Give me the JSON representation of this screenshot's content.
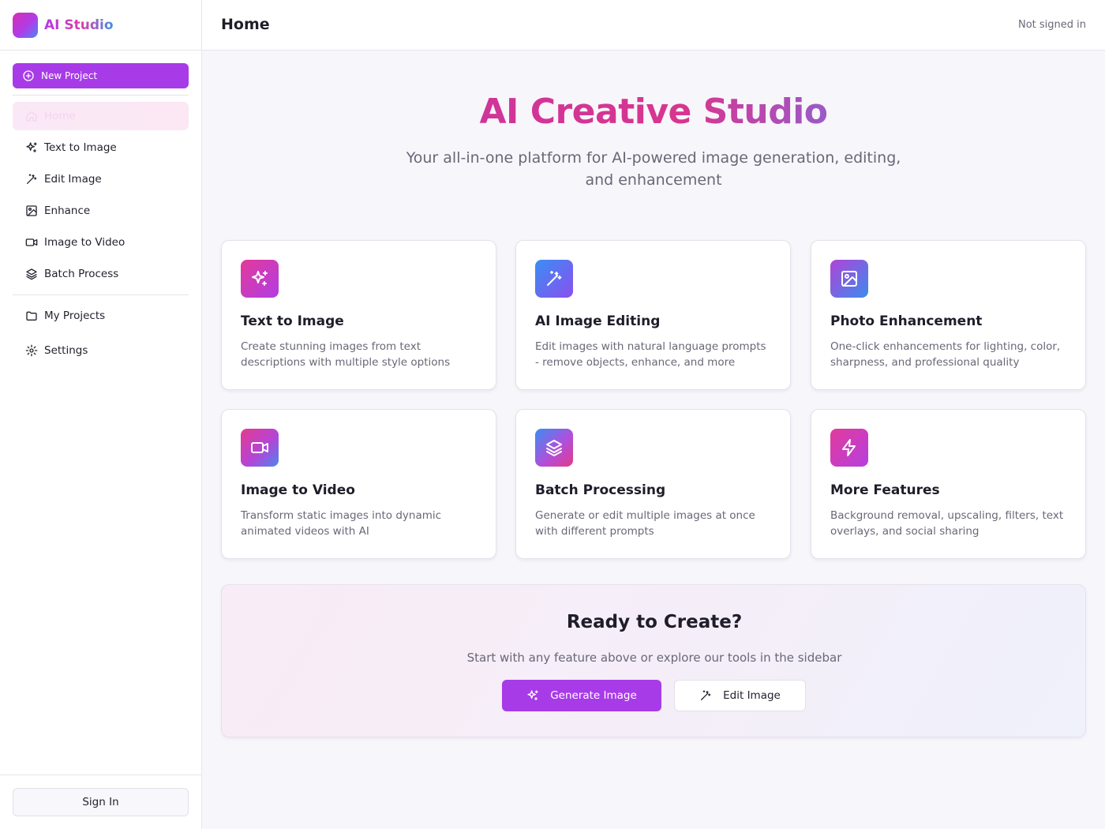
{
  "app": {
    "name": "AI Studio"
  },
  "sidebar": {
    "new_project_label": "New Project",
    "items": [
      {
        "label": "Home",
        "icon": "home-icon"
      },
      {
        "label": "Text to Image",
        "icon": "sparkles-icon"
      },
      {
        "label": "Edit Image",
        "icon": "wand-icon"
      },
      {
        "label": "Enhance",
        "icon": "image-icon"
      },
      {
        "label": "Image to Video",
        "icon": "video-icon"
      },
      {
        "label": "Batch Process",
        "icon": "layers-icon"
      },
      {
        "label": "My Projects",
        "icon": "folder-icon"
      },
      {
        "label": "Settings",
        "icon": "gear-icon"
      }
    ],
    "sign_in_label": "Sign In"
  },
  "header": {
    "title": "Home",
    "status": "Not signed in"
  },
  "hero": {
    "title": "AI Creative Studio",
    "subtitle": "Your all-in-one platform for AI-powered image generation, editing, and enhancement"
  },
  "features": [
    {
      "title": "Text to Image",
      "description": "Create stunning images from text descriptions with multiple style options",
      "icon": "sparkles-icon"
    },
    {
      "title": "AI Image Editing",
      "description": "Edit images with natural language prompts - remove objects, enhance, and more",
      "icon": "wand-icon"
    },
    {
      "title": "Photo Enhancement",
      "description": "One-click enhancements for lighting, color, sharpness, and professional quality",
      "icon": "image-icon"
    },
    {
      "title": "Image to Video",
      "description": "Transform static images into dynamic animated videos with AI",
      "icon": "video-icon"
    },
    {
      "title": "Batch Processing",
      "description": "Generate or edit multiple images at once with different prompts",
      "icon": "layers-icon"
    },
    {
      "title": "More Features",
      "description": "Background removal, upscaling, filters, text overlays, and social sharing",
      "icon": "bolt-icon"
    }
  ],
  "cta": {
    "title": "Ready to Create?",
    "subtitle": "Start with any feature above or explore our tools in the sidebar",
    "primary_label": "Generate Image",
    "secondary_label": "Edit Image"
  },
  "colors": {
    "accent": "#a83be8",
    "brand_pink": "#d8358f",
    "brand_blue": "#3b92e6"
  }
}
